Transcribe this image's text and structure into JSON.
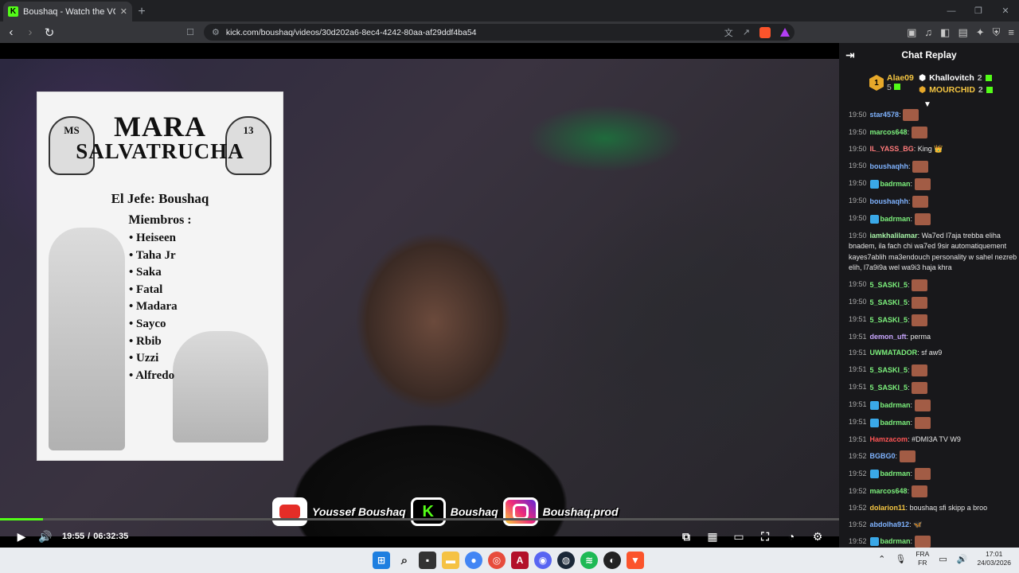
{
  "browser": {
    "tab_title": "Boushaq - Watch the VOD on Ki",
    "url": "kick.com/boushaq/videos/30d202a6-8ec4-4242-80aa-af29ddf4ba54",
    "new_tab": "+",
    "close": "✕"
  },
  "poster": {
    "title_line1": "MARA",
    "title_line2": "SALVATRUCHA",
    "skull_left": "MS",
    "skull_right": "13",
    "jefe": "El Jefe: Boushaq",
    "miembros_label": "Miembros :",
    "members": [
      "Heiseen",
      "Taha Jr",
      "Saka",
      "Fatal",
      "Madara",
      "Sayco",
      "Rbib",
      "Uzzi",
      "Alfredo"
    ]
  },
  "overlay": {
    "youtube": "Youssef Boushaq",
    "kick": "Boushaq",
    "instagram": "Boushaq.prod"
  },
  "player": {
    "current_time": "19:55",
    "duration": "06:32:35",
    "progress_fraction": 0.051
  },
  "chat": {
    "title": "Chat Replay",
    "leaders": [
      {
        "rank": "1",
        "name": "Alae09",
        "count": "5"
      },
      {
        "name": "Khallovitch",
        "count": "2"
      },
      {
        "name": "MOURCHID",
        "count": "2"
      }
    ],
    "messages": [
      {
        "time": "19:50",
        "user": "star4578",
        "color": "#7fb3ff",
        "badge": false,
        "text": "",
        "emote": true
      },
      {
        "time": "19:50",
        "user": "marcos648",
        "color": "#7cf07c",
        "badge": false,
        "text": "",
        "emote": true
      },
      {
        "time": "19:50",
        "user": "IL_YASS_BG",
        "color": "#ff7a7a",
        "badge": false,
        "text": "King 👑",
        "emote": false
      },
      {
        "time": "19:50",
        "user": "boushaqhh",
        "color": "#7fb3ff",
        "badge": false,
        "text": "",
        "emote": true
      },
      {
        "time": "19:50",
        "user": "badrman",
        "color": "#7cf07c",
        "badge": true,
        "text": "",
        "emote": true
      },
      {
        "time": "19:50",
        "user": "boushaqhh",
        "color": "#7fb3ff",
        "badge": false,
        "text": "",
        "emote": true
      },
      {
        "time": "19:50",
        "user": "badrman",
        "color": "#7cf07c",
        "badge": true,
        "text": "",
        "emote": true
      },
      {
        "time": "19:50",
        "user": "iamkhalilamar",
        "color": "#a7f3a7",
        "badge": false,
        "text": "Wa7ed l7aja trebba eliha bnadem, ila fach chi wa7ed 9sir automatiquement kayes7ablih ma3endouch personality w sahel nezreb elih, l7a9i9a wel wa9i3 haja khra",
        "emote": false
      },
      {
        "time": "19:50",
        "user": "5_SASKI_5",
        "color": "#7cf07c",
        "badge": false,
        "text": "",
        "emote": true
      },
      {
        "time": "19:50",
        "user": "5_SASKI_5",
        "color": "#7cf07c",
        "badge": false,
        "text": "",
        "emote": true
      },
      {
        "time": "19:51",
        "user": "5_SASKI_5",
        "color": "#7cf07c",
        "badge": false,
        "text": "",
        "emote": true
      },
      {
        "time": "19:51",
        "user": "demon_uft",
        "color": "#c9a7ff",
        "badge": false,
        "text": "perma",
        "emote": false
      },
      {
        "time": "19:51",
        "user": "UWMATADOR",
        "color": "#7cf07c",
        "badge": false,
        "text": "sf aw9",
        "emote": false
      },
      {
        "time": "19:51",
        "user": "5_SASKI_5",
        "color": "#7cf07c",
        "badge": false,
        "text": "",
        "emote": true
      },
      {
        "time": "19:51",
        "user": "5_SASKI_5",
        "color": "#7cf07c",
        "badge": false,
        "text": "",
        "emote": true
      },
      {
        "time": "19:51",
        "user": "badrman",
        "color": "#7cf07c",
        "badge": true,
        "text": "",
        "emote": true
      },
      {
        "time": "19:51",
        "user": "badrman",
        "color": "#7cf07c",
        "badge": true,
        "text": "",
        "emote": true
      },
      {
        "time": "19:51",
        "user": "Hamzacom",
        "color": "#ff5555",
        "badge": false,
        "text": "#DMI3A TV W9",
        "emote": false
      },
      {
        "time": "19:52",
        "user": "BGBG0",
        "color": "#7fb3ff",
        "badge": false,
        "text": "",
        "emote": true
      },
      {
        "time": "19:52",
        "user": "badrman",
        "color": "#7cf07c",
        "badge": true,
        "text": "",
        "emote": true
      },
      {
        "time": "19:52",
        "user": "marcos648",
        "color": "#7cf07c",
        "badge": false,
        "text": "",
        "emote": true
      },
      {
        "time": "19:52",
        "user": "dolarion11",
        "color": "#f4c542",
        "badge": false,
        "text": "boushaq sfi skipp a broo",
        "emote": false
      },
      {
        "time": "19:52",
        "user": "abdolha912",
        "color": "#7fb3ff",
        "badge": false,
        "text": "🦋",
        "emote": false
      },
      {
        "time": "19:52",
        "user": "badrman",
        "color": "#7cf07c",
        "badge": true,
        "text": "",
        "emote": true
      }
    ]
  },
  "taskbar": {
    "lang_top": "FRA",
    "lang_bottom": "FR",
    "time": "17:01",
    "date": "24/03/2026"
  }
}
